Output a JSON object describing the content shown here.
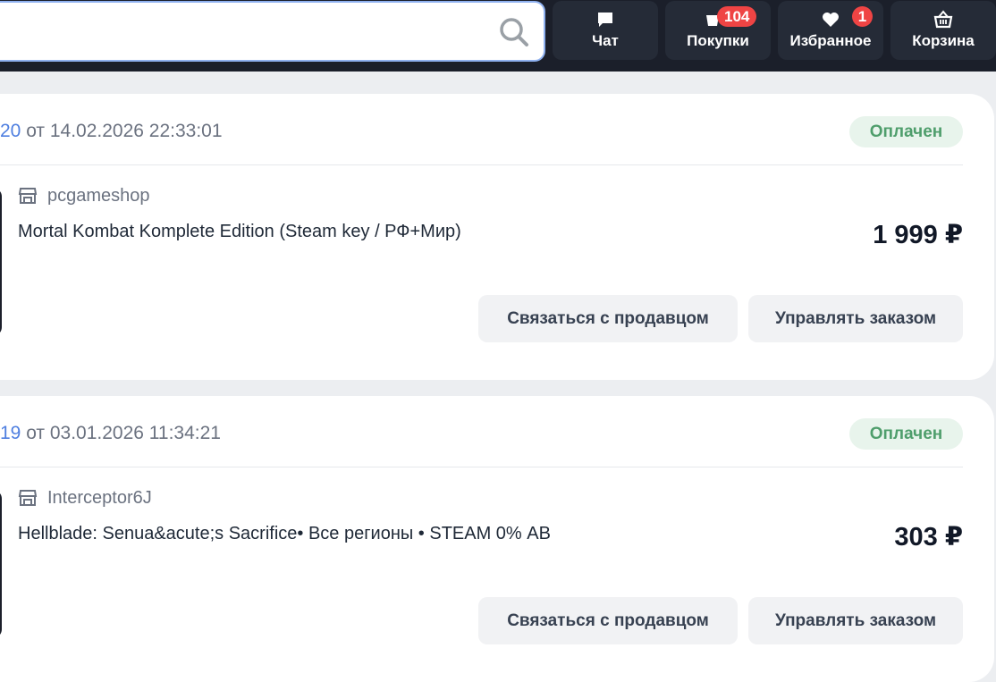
{
  "header": {
    "search_placeholder": "",
    "nav": [
      {
        "label": "Чат",
        "icon": "chat-icon"
      },
      {
        "label": "Покупки",
        "icon": "purchases-icon",
        "badge": "104"
      },
      {
        "label": "Избранное",
        "icon": "heart-icon",
        "badge": "1"
      },
      {
        "label": "Корзина",
        "icon": "basket-icon"
      }
    ]
  },
  "orders": [
    {
      "number": "20",
      "date_text": " от 14.02.2026 22:33:01",
      "status": "Оплачен",
      "seller": "pcgameshop",
      "product": "Mortal Kombat Komplete Edition (Steam key / РФ+Мир)",
      "price": "1 999 ₽",
      "contact_label": "Связаться с продавцом",
      "manage_label": "Управлять заказом"
    },
    {
      "number": "19",
      "date_text": " от 03.01.2026 11:34:21",
      "status": "Оплачен",
      "seller": "Interceptor6J",
      "product": "Hellblade: Senua&acute;s Sacrifice• Все регионы • STEAM 0% АВ",
      "price": "303 ₽",
      "contact_label": "Связаться с продавцом",
      "manage_label": "Управлять заказом"
    }
  ],
  "colors": {
    "header_bg": "#1b1f2a",
    "accent_link": "#4f7fe0",
    "status_paid": "#4f9e6c",
    "badge": "#ef4444"
  }
}
